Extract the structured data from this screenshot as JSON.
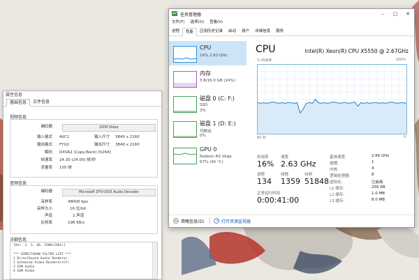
{
  "colors": {
    "cpu_graph": "#1e7fcf",
    "memory_graph": "#8a3fb5",
    "disk_graph": "#4a9a5a",
    "selected_item": "#cce4f7",
    "link": "#1a5fb4"
  },
  "media_info": {
    "title": "属性信息",
    "tabs": [
      "基础信息",
      "文件信息"
    ],
    "video_section": "视频信息",
    "video_decoder_label": "编码器",
    "video_decoder": "GXM Video",
    "video_rows": [
      {
        "l1": "输入格式",
        "v1": "AVC1",
        "l2": "输入尺寸",
        "v2": "3840 x 2160"
      },
      {
        "l1": "输出格式",
        "v1": "FYU2",
        "l2": "输出尺寸",
        "v2": "3840 x 2160"
      },
      {
        "l1": "解码",
        "v1": "DXVA2 (Copy-Back) [h264]",
        "l2": "",
        "v2": ""
      },
      {
        "l1": "帧速率",
        "v1": "24.30 (24.00) 帧/秒",
        "l2": "",
        "v2": ""
      },
      {
        "l1": "流量率",
        "v1": "105 帧",
        "l2": "",
        "v2": ""
      }
    ],
    "audio_section": "音频信息",
    "audio_decoder_label": "编码器",
    "audio_decoder": "Microsoft DTV-DVD Audio Decoder",
    "audio_rows": [
      {
        "l": "采样率",
        "v": "48000 bps"
      },
      {
        "l": "采样大小",
        "v": "16 位/bit"
      },
      {
        "l": "声道",
        "v": "2 声道"
      },
      {
        "l": "比特率",
        "v": "196 KB/s"
      }
    ],
    "detail_section": "详细信息",
    "log_lines": [
      "[Ver. 2. 3. 46. 5300(2301)]",
      "",
      "*** DIRECTSHOW FILTER LIST ***",
      "1  DirectSound Audio Renderer",
      "2  Enhanced Video Renderer(CF)",
      "3  GXM Audio",
      "4  GXM Video"
    ]
  },
  "taskmgr": {
    "title": "任务管理器",
    "menu": [
      "文件(F)",
      "选项(O)",
      "查看(V)"
    ],
    "tabs": [
      "进程",
      "性能",
      "应用历史记录",
      "启动",
      "用户",
      "详细信息",
      "服务"
    ],
    "active_tab": "性能",
    "sidebar": [
      {
        "name": "CPU",
        "sub1": "16% 2.63 GHz",
        "sub2": ""
      },
      {
        "name": "内存",
        "sub1": "3.8/16.0 GB (24%)",
        "sub2": ""
      },
      {
        "name": "磁盘 0 (C: F:)",
        "sub1": "SSD",
        "sub2": "3%"
      },
      {
        "name": "磁盘 1 (D: E:)",
        "sub1": "可移动",
        "sub2": "0%"
      },
      {
        "name": "GPU 0",
        "sub1": "Radeon RX Vega",
        "sub2": "67% (40 °C)"
      }
    ],
    "cpu": {
      "heading": "CPU",
      "model": "Intel(R) Xeon(R) CPU X5550 @ 2.67GHz",
      "graph_caption_left": "% 利用率",
      "graph_caption_right": "100%",
      "graph_foot_left": "60 秒",
      "graph_foot_right": "0",
      "utilization_label": "利用率",
      "utilization": "16%",
      "speed_label": "速度",
      "speed": "2.63 GHz",
      "processes_label": "进程",
      "processes": "134",
      "threads_label": "线程",
      "threads": "1359",
      "handles_label": "句柄",
      "handles": "51848",
      "uptime_label": "正常运行时间",
      "uptime": "0:00:41:00",
      "info": [
        {
          "label": "基准速度:",
          "value": "2.66 GHz"
        },
        {
          "label": "插槽:",
          "value": "1"
        },
        {
          "label": "内核:",
          "value": "4"
        },
        {
          "label": "逻辑处理器:",
          "value": "8"
        },
        {
          "label": "虚拟化:",
          "value": "已启用"
        },
        {
          "label": "L1 缓存:",
          "value": "256 KB"
        },
        {
          "label": "L2 缓存:",
          "value": "1.0 MB"
        },
        {
          "label": "L3 缓存:",
          "value": "8.0 MB"
        }
      ],
      "utilization_history": [
        45,
        44,
        45,
        44,
        45,
        46,
        45,
        44,
        45,
        44,
        45,
        45,
        44,
        45,
        30,
        36,
        44,
        45,
        44,
        50,
        45,
        44,
        45,
        44,
        45,
        46,
        45,
        44,
        45,
        45,
        44,
        45,
        46,
        40,
        45,
        44,
        45,
        44,
        45,
        45,
        44,
        45,
        44,
        45,
        46,
        45,
        44,
        45,
        45,
        44
      ]
    },
    "footer": {
      "fewer_details": "简略信息(D)",
      "open_monitor": "打开资源监视器"
    }
  }
}
